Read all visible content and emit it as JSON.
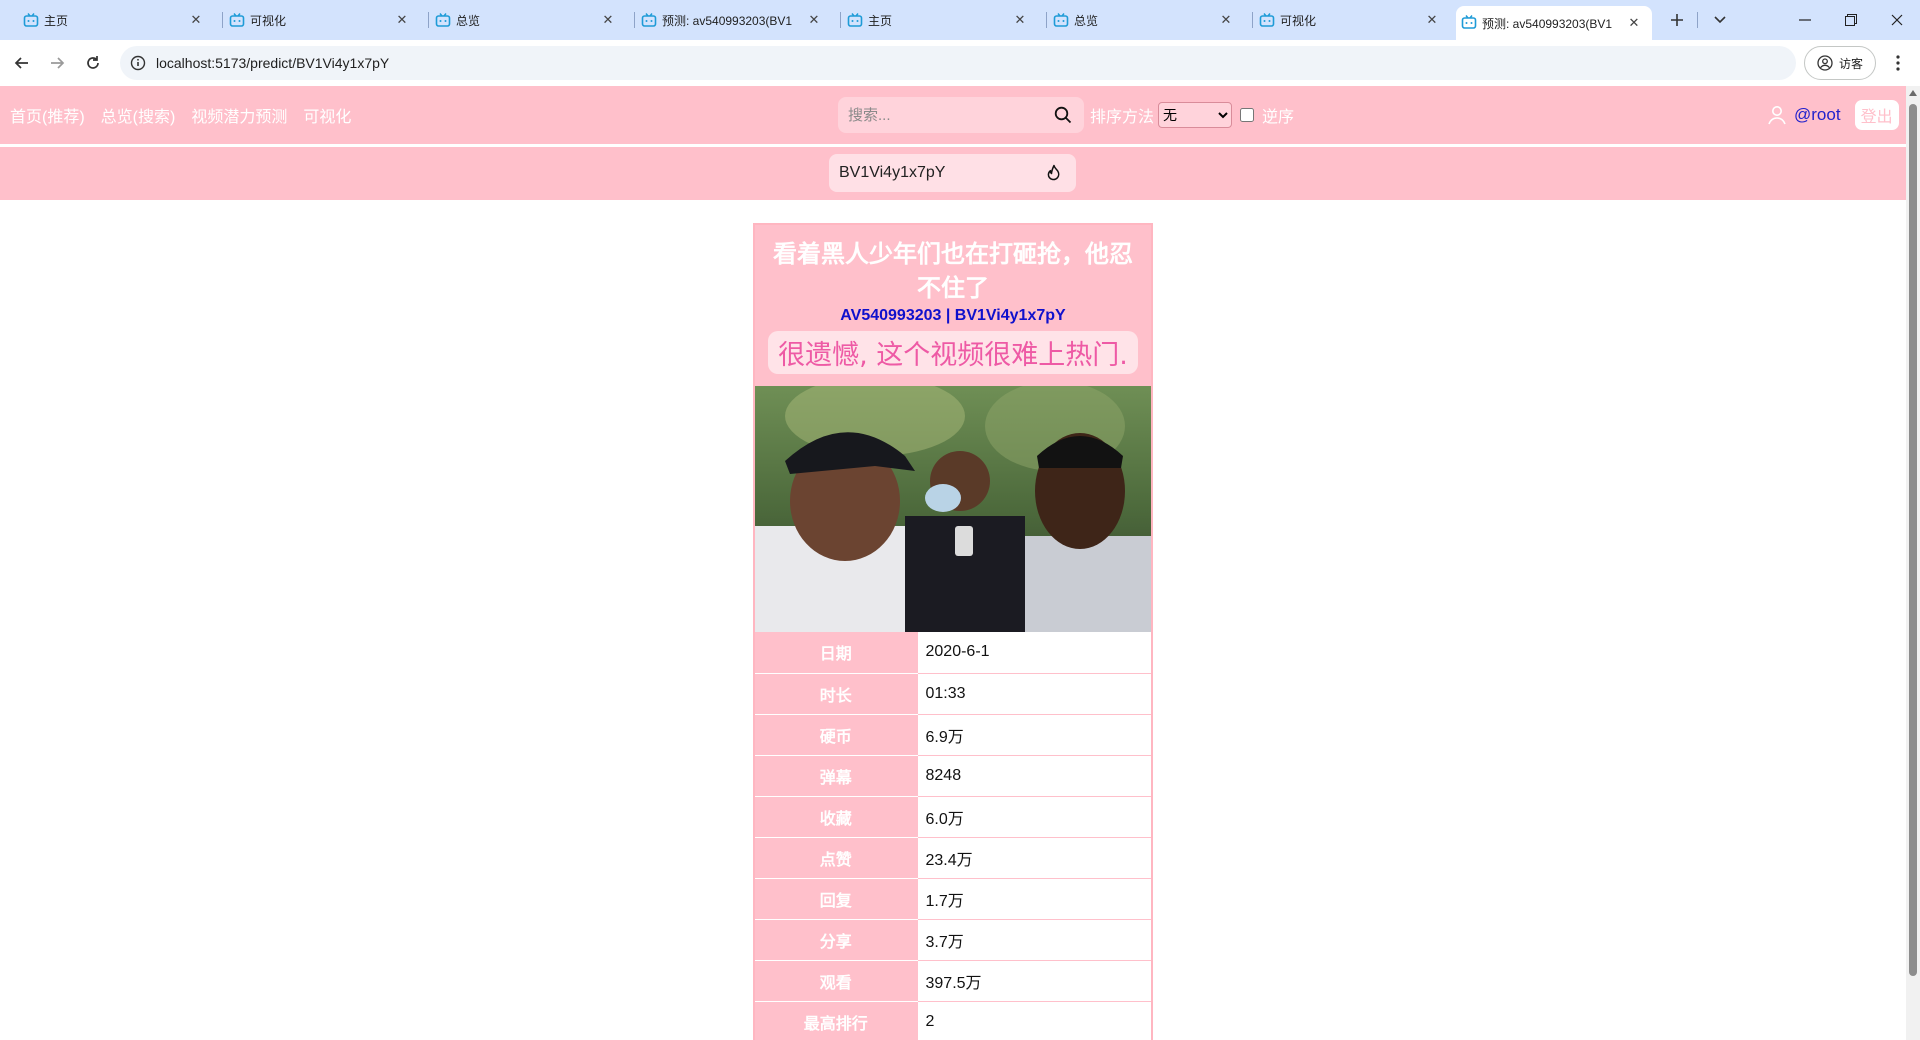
{
  "browser": {
    "tabs": [
      {
        "title": "主页",
        "active": false
      },
      {
        "title": "可视化",
        "active": false
      },
      {
        "title": "总览",
        "active": false
      },
      {
        "title": "预测: av540993203(BV1",
        "active": false
      },
      {
        "title": "主页",
        "active": false
      },
      {
        "title": "总览",
        "active": false
      },
      {
        "title": "可视化",
        "active": false
      },
      {
        "title": "预测: av540993203(BV1",
        "active": true
      }
    ],
    "url": "localhost:5173/predict/BV1Vi4y1x7pY",
    "profile_label": "访客"
  },
  "appbar": {
    "nav": [
      "首页(推荐)",
      "总览(搜索)",
      "视频潜力预测",
      "可视化"
    ],
    "search_placeholder": "搜索...",
    "sort_label": "排序方法",
    "sort_selected": "无",
    "reverse_label": "逆序",
    "username": "@root",
    "logout_label": "登出"
  },
  "predict": {
    "bv_input_value": "BV1Vi4y1x7pY"
  },
  "video": {
    "title": "看着黑人少年们也在打砸抢，他忍不住了",
    "ids": "AV540993203 | BV1Vi4y1x7pY",
    "verdict": "很遗憾, 这个视频很难上热门.",
    "stats": [
      {
        "label": "日期",
        "value": "2020-6-1"
      },
      {
        "label": "时长",
        "value": "01:33"
      },
      {
        "label": "硬币",
        "value": "6.9万"
      },
      {
        "label": "弹幕",
        "value": "8248"
      },
      {
        "label": "收藏",
        "value": "6.0万"
      },
      {
        "label": "点赞",
        "value": "23.4万"
      },
      {
        "label": "回复",
        "value": "1.7万"
      },
      {
        "label": "分享",
        "value": "3.7万"
      },
      {
        "label": "观看",
        "value": "397.5万"
      },
      {
        "label": "最高排行",
        "value": "2"
      }
    ]
  },
  "colors": {
    "brand_pink": "#ffc0cb",
    "tab_strip": "#d3e3fd",
    "ids_blue": "#1010cc",
    "verdict_pink": "#ee5aa5"
  }
}
